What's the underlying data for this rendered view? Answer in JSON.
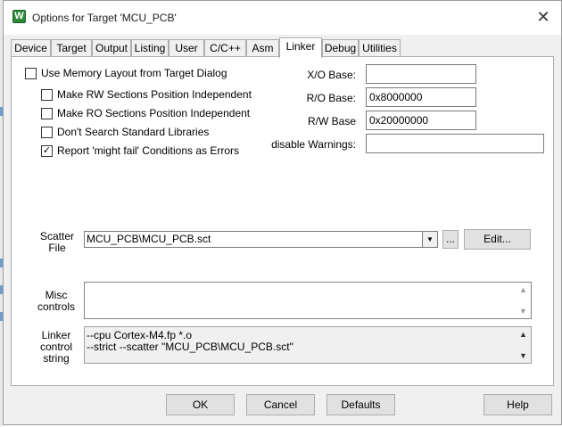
{
  "window": {
    "title": "Options for Target 'MCU_PCB'",
    "icon_letter": "W",
    "close_glyph": "✕"
  },
  "tabs": [
    {
      "label": "Device"
    },
    {
      "label": "Target"
    },
    {
      "label": "Output"
    },
    {
      "label": "Listing"
    },
    {
      "label": "User"
    },
    {
      "label": "C/C++"
    },
    {
      "label": "Asm"
    },
    {
      "label": "Linker",
      "active": true
    },
    {
      "label": "Debug"
    },
    {
      "label": "Utilities"
    }
  ],
  "options": {
    "use_memory_layout": {
      "label": "Use Memory Layout from Target Dialog",
      "checked": false
    },
    "rw_independent": {
      "label": "Make RW Sections Position Independent",
      "checked": false
    },
    "ro_independent": {
      "label": "Make RO Sections Position Independent",
      "checked": false
    },
    "no_std_libs": {
      "label": "Don't Search Standard Libraries",
      "checked": false
    },
    "might_fail_errors": {
      "label": "Report 'might fail' Conditions as Errors",
      "checked": true,
      "mark": "✓"
    }
  },
  "bases": {
    "xo_label": "X/O Base:",
    "xo_value": "",
    "ro_label": "R/O Base:",
    "ro_value": "0x8000000",
    "rw_label": "R/W Base",
    "rw_value": "0x20000000",
    "warnings_label": "disable Warnings:",
    "warnings_value": ""
  },
  "scatter": {
    "label_line1": "Scatter",
    "label_line2": "File",
    "value": "MCU_PCB\\MCU_PCB.sct",
    "browse_label": "...",
    "edit_label": "Edit..."
  },
  "misc": {
    "label_line1": "Misc",
    "label_line2": "controls",
    "value": ""
  },
  "linker_string": {
    "label_line1": "Linker",
    "label_line2": "control",
    "label_line3": "string",
    "line1": "--cpu Cortex-M4.fp *.o",
    "line2": "--strict --scatter \"MCU_PCB\\MCU_PCB.sct\""
  },
  "buttons": {
    "ok": "OK",
    "cancel": "Cancel",
    "defaults": "Defaults",
    "help": "Help"
  },
  "glyphs": {
    "dropdown": "▼",
    "scroll_up": "▲",
    "scroll_down": "▼"
  }
}
